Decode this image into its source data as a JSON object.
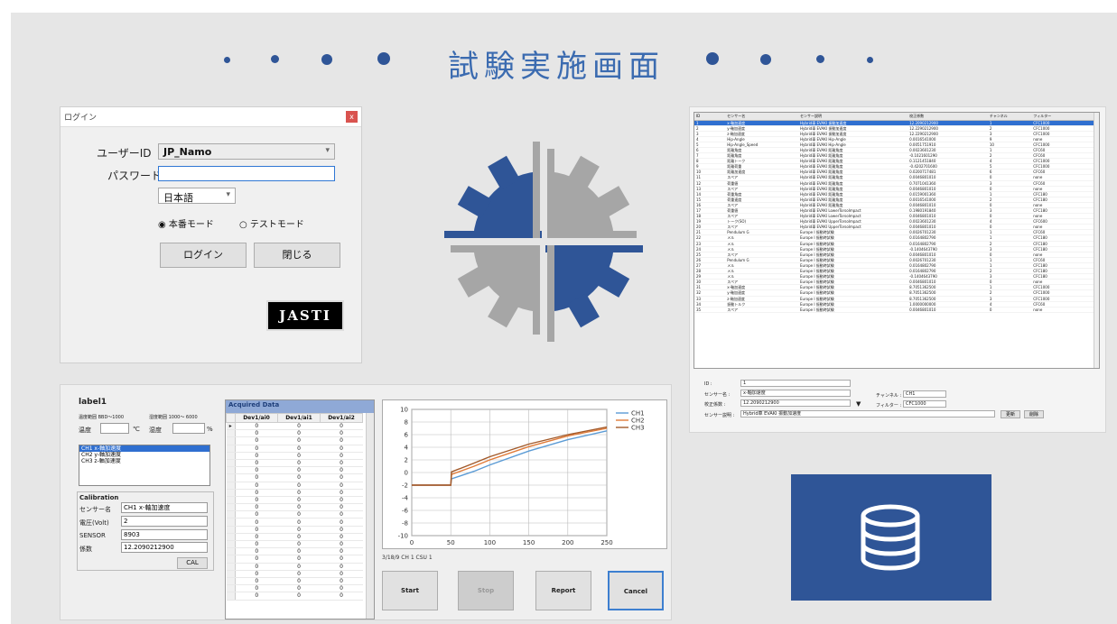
{
  "title": "試験実施画面",
  "login": {
    "window_title": "ログイン",
    "close_glyph": "x",
    "userid_label": "ユーザーID",
    "userid_value": "JP_Namo",
    "password_label": "パスワード",
    "password_value": "",
    "language_value": "日本語",
    "mode_production": "本番モード",
    "mode_test": "テストモード",
    "login_button": "ログイン",
    "close_button": "閉じる",
    "logo_text": "JASTI"
  },
  "sensor_table": {
    "columns": [
      "ID",
      "センサー名",
      "センサー説明",
      "校正係数",
      "チャンネル",
      "フィルター"
    ],
    "rows": [
      [
        "1",
        "x-軸加速度",
        "Hybrid車 EVAKI 振動加速度",
        "12.2090212900",
        "1",
        "CFC1000"
      ],
      [
        "2",
        "y-軸加速度",
        "Hybrid車 EVAKI 振動加速度",
        "12.2290212900",
        "2",
        "CFC1000"
      ],
      [
        "3",
        "z-軸加速度",
        "Hybrid車 EVAKI 振動加速度",
        "12.2290212900",
        "3",
        "CFC1000"
      ],
      [
        "4",
        "Hip-Angle",
        "Hybrid車 EVAKI Hip-Angle",
        "0.0016541000",
        "9",
        "none"
      ],
      [
        "5",
        "Hip-Angle_Speed",
        "Hybrid車 EVAKI Hip-Angle",
        "0.0051751910",
        "10",
        "CFC1000"
      ],
      [
        "6",
        "距離角度",
        "Hybrid車 EVAKI 距離角度",
        "0.0023601230",
        "1",
        "CFC60"
      ],
      [
        "7",
        "距離角度",
        "Hybrid車 EVAKI 距離角度",
        "-0.1021601290",
        "2",
        "CFC60"
      ],
      [
        "8",
        "距離トーク",
        "Hybrid車 EVAKI 距離角度",
        "0.1121451840",
        "4",
        "CFC1000"
      ],
      [
        "9",
        "距離荷重",
        "Hybrid車 EVAKI 距離角度",
        "-0.4202701600",
        "5",
        "CFC1000"
      ],
      [
        "10",
        "距離加速度",
        "Hybrid車 EVAKI 距離角度",
        "0.0200717481",
        "6",
        "CFC60"
      ],
      [
        "11",
        "スペア",
        "Hybrid車 EVAKI 距離角度",
        "0.0046801010",
        "0",
        "none"
      ],
      [
        "12",
        "荷重値",
        "Hybrid車 EVAKI 距離角度",
        "0.7071041360",
        "3",
        "CFC60"
      ],
      [
        "13",
        "スペア",
        "Hybrid車 EVAKI 距離角度",
        "0.0046801010",
        "0",
        "none"
      ],
      [
        "14",
        "荷重角度",
        "Hybrid車 EVAKI 距離角度",
        "0.0159001360",
        "1",
        "CFC180"
      ],
      [
        "15",
        "荷重速度",
        "Hybrid車 EVAKI 距離角度",
        "0.0016541000",
        "2",
        "CFC180"
      ],
      [
        "16",
        "スペア",
        "Hybrid車 EVAKI 距離角度",
        "0.0046801010",
        "0",
        "none"
      ],
      [
        "17",
        "荷重値",
        "Hybrid車 EVAKI LowerTorsoImpact",
        "0.1980191840",
        "3",
        "CFC180"
      ],
      [
        "18",
        "スペア",
        "Hybrid車 EVAKI LowerTorsoImpact",
        "0.0046801010",
        "0",
        "none"
      ],
      [
        "19",
        "トーク(SO)",
        "Hybrid車 EVAKI UpperTorsoImpact",
        "0.0023601230",
        "4",
        "CFC600"
      ],
      [
        "20",
        "スペア",
        "Hybrid車 EVAKI UpperTorsoImpact",
        "0.0046801010",
        "0",
        "none"
      ],
      [
        "21",
        "Pendulum G",
        "Europe I 振動時試験",
        "0.0026701230",
        "1",
        "CFC60"
      ],
      [
        "22",
        "メル",
        "Europe I 振動時試験",
        "0.0164802790",
        "1",
        "CFC180"
      ],
      [
        "23",
        "メル",
        "Europe I 振動時試験",
        "0.0164802790",
        "2",
        "CFC180"
      ],
      [
        "24",
        "メル",
        "Europe I 振動時試験",
        "-0.1404643790",
        "3",
        "CFC180"
      ],
      [
        "25",
        "スペア",
        "Europe I 振動時試験",
        "0.0046801010",
        "0",
        "none"
      ],
      [
        "26",
        "Pendulum G",
        "Europe I 振動時試験",
        "0.0026701230",
        "1",
        "CFC60"
      ],
      [
        "27",
        "メル",
        "Europe I 振動時試験",
        "0.0164802790",
        "1",
        "CFC180"
      ],
      [
        "28",
        "メル",
        "Europe I 振動時試験",
        "0.0164802790",
        "2",
        "CFC180"
      ],
      [
        "29",
        "メル",
        "Europe I 振動時試験",
        "-0.1404643790",
        "3",
        "CFC180"
      ],
      [
        "30",
        "スペア",
        "Europe I 振動時試験",
        "0.0046801010",
        "0",
        "none"
      ],
      [
        "31",
        "x-軸加速度",
        "Europe I 振動時試験",
        "8.7051362500",
        "1",
        "CFC1000"
      ],
      [
        "32",
        "y-軸加速度",
        "Europe I 振動時試験",
        "8.7051362500",
        "2",
        "CFC1000"
      ],
      [
        "33",
        "z-軸加速度",
        "Europe I 振動時試験",
        "8.7051362500",
        "3",
        "CFC1000"
      ],
      [
        "34",
        "振動トルク",
        "Europe I 振動時試験",
        "1.0000000000",
        "4",
        "CFC60"
      ],
      [
        "35",
        "スペア",
        "Europe I 振動時試験",
        "0.0046801010",
        "0",
        "none"
      ]
    ],
    "form": {
      "id_label": "ID :",
      "id_value": "1",
      "name_label": "センサー名 :",
      "name_value": "x-軸加速度",
      "coef_label": "校正係数 :",
      "coef_value": "12.2090212900",
      "desc_label": "センサー説明 :",
      "desc_value": "Hybrid車 EVAKI 振動加速度",
      "channel_label": "チャンネル :",
      "channel_value": "CH1",
      "filter_label": "フィルター :",
      "filter_value": "CFC1000",
      "update_button": "更新",
      "delete_button": "削除"
    }
  },
  "acquisition": {
    "label1": "label1",
    "temp_range_label": "温度範囲 BBD～1000",
    "humidity_range_label": "湿度範囲 1000～ 6000",
    "temp_label": "温度",
    "temp_unit": "℃",
    "humidity_label": "湿度",
    "humidity_unit": "%",
    "channels": [
      "CH1 x-軸加速度",
      "CH2 y-軸加速度",
      "CH3 z-軸加速度"
    ],
    "calibration_title": "Calibration",
    "cal_sensor_label": "センサー名",
    "cal_sensor_value": "CH1 x-軸加速度",
    "cal_voltage_label": "電圧(Volt)",
    "cal_voltage_value": "2",
    "cal_sensor_id_label": "SENSOR",
    "cal_sensor_id_value": "8903",
    "cal_coef_label": "係数",
    "cal_coef_value": "12.2090212900",
    "cal_button": "CAL",
    "acquired_title": "Acquired Data",
    "acq_columns": [
      "Dev1/ai0",
      "Dev1/ai1",
      "Dev1/ai2"
    ],
    "acq_rows": 24,
    "acq_cell": "0",
    "status": "3/18/9 CH 1 CSU 1",
    "buttons": {
      "start": "Start",
      "stop": "Stop",
      "report": "Report",
      "cancel": "Cancel"
    }
  },
  "chart_data": {
    "type": "line",
    "title": "",
    "xlabel": "",
    "ylabel": "",
    "xlim": [
      0,
      250
    ],
    "ylim": [
      -10,
      10
    ],
    "xticks": [
      0,
      50,
      100,
      150,
      200,
      250
    ],
    "yticks": [
      10,
      8,
      6,
      4,
      2,
      0,
      -2,
      -4,
      -6,
      -8,
      -10
    ],
    "legend_position": "top-right",
    "series": [
      {
        "name": "CH1",
        "color": "#5b9bd5",
        "x": [
          0,
          50,
          51,
          80,
          100,
          150,
          200,
          250
        ],
        "y": [
          -2,
          -2,
          -1,
          0.2,
          1.2,
          3.4,
          5.2,
          6.6
        ]
      },
      {
        "name": "CH2",
        "color": "#e07b39",
        "x": [
          0,
          50,
          51,
          80,
          100,
          150,
          200,
          250
        ],
        "y": [
          -2,
          -2,
          -0.3,
          1.0,
          2.0,
          4.1,
          5.8,
          7.0
        ]
      },
      {
        "name": "CH3",
        "color": "#a35a2a",
        "x": [
          0,
          50,
          51,
          80,
          100,
          150,
          200,
          250
        ],
        "y": [
          -2,
          -2,
          0.1,
          1.5,
          2.5,
          4.5,
          6.0,
          7.2
        ]
      }
    ]
  }
}
